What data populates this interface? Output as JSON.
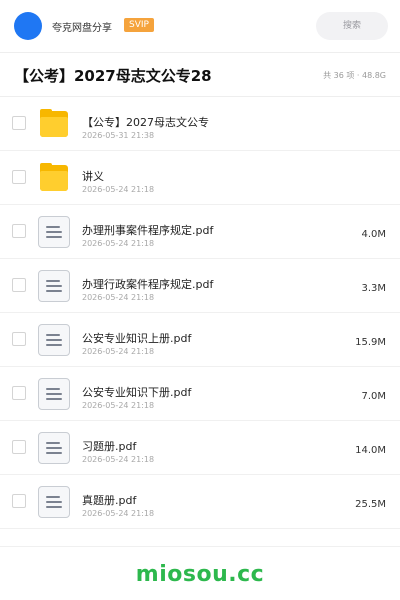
{
  "header": {
    "username": "夸克网盘分享",
    "badge": "SVIP",
    "search_placeholder": "搜索"
  },
  "share": {
    "title": "【公考】2027母志文公专28",
    "meta": "共 36 项 · 48.8G"
  },
  "files": [
    {
      "name": "【公专】2027母志文公专",
      "date": "2026-05-31 21:38",
      "size": "",
      "icon": "folder-icon"
    },
    {
      "name": "讲义",
      "date": "2026-05-24 21:18",
      "size": "",
      "icon": "folder-icon"
    },
    {
      "name": "办理刑事案件程序规定.pdf",
      "date": "2026-05-24 21:18",
      "size": "4.0M",
      "icon": "document-icon"
    },
    {
      "name": "办理行政案件程序规定.pdf",
      "date": "2026-05-24 21:18",
      "size": "3.3M",
      "icon": "document-icon"
    },
    {
      "name": "公安专业知识上册.pdf",
      "date": "2026-05-24 21:18",
      "size": "15.9M",
      "icon": "document-icon"
    },
    {
      "name": "公安专业知识下册.pdf",
      "date": "2026-05-24 21:18",
      "size": "7.0M",
      "icon": "document-icon"
    },
    {
      "name": "习题册.pdf",
      "date": "2026-05-24 21:18",
      "size": "14.0M",
      "icon": "document-icon"
    },
    {
      "name": "真题册.pdf",
      "date": "2026-05-24 21:18",
      "size": "25.5M",
      "icon": "document-icon"
    }
  ],
  "watermark": "miosou.cc",
  "colors": {
    "accent_blue": "#1f77f3",
    "svip_orange": "#f5a33c",
    "folder_yellow": "#ffce2e",
    "watermark_green": "#2db84d"
  }
}
